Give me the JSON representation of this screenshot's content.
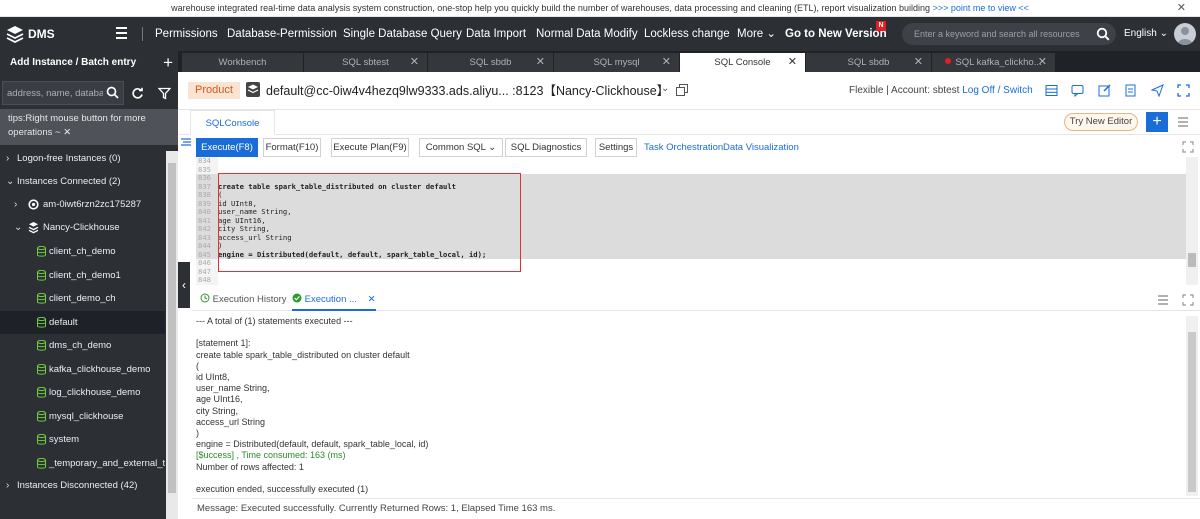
{
  "announcement": {
    "text": "warehouse integrated real-time data analysis system construction, one-stop help you quickly build the number of warehouses, data processing and cleaning (ETL), report visualization building",
    "link": ">>> point me to view <<"
  },
  "topnav": {
    "brand": "DMS",
    "menu": [
      "Permissions",
      "Database-Permission",
      "Single Database Query",
      "Data Import",
      "Normal Data Modify",
      "Lockless change",
      "More"
    ],
    "new_version": "Go to New Version",
    "new_badge": "N",
    "search_placeholder": "Enter a keyword and search all resources",
    "language": "English"
  },
  "left": {
    "add_instance": "Add Instance / Batch entry",
    "filter_placeholder": "address, name, databa",
    "tips_line1": "tips:Right mouse button for more",
    "tips_line2": "operations ~",
    "tree": {
      "logon_free": "Logon-free Instances  (0)",
      "connected": "Instances Connected  (2)",
      "inst1": "am-0iwt6rzn2zc175287",
      "inst2": "Nancy-Clickhouse",
      "dbs": [
        "client_ch_demo",
        "client_ch_demo1",
        "client_demo_ch",
        "default",
        "dms_ch_demo",
        "kafka_clickhouse_demo",
        "log_clickhouse_demo",
        "mysql_clickhouse",
        "system",
        "_temporary_and_external_ta"
      ],
      "disconnected": "Instances Disconnected  (42)"
    }
  },
  "tabs": [
    "Workbench",
    "SQL sbtest",
    "SQL sbdb",
    "SQL mysql",
    "SQL Console",
    "SQL sbdb",
    "SQL kafka_clickho..."
  ],
  "connection": {
    "product": "Product",
    "text": "default@cc-0iw4v4hezq9lw9333.ads.aliyu... :8123【Nancy-Clickhouse】",
    "account_prefix": "Flexible | Account: sbtest",
    "logoff": "Log Off / Switch"
  },
  "console": {
    "subtab": "SQLConsole",
    "try_new": "Try New Editor"
  },
  "actions": {
    "execute": "Execute(F8)",
    "format": "Format(F10)",
    "plan": "Execute Plan(F9)",
    "common_sql": "Common SQL",
    "diagnostics": "SQL Diagnostics",
    "settings": "Settings",
    "orchestration": "Task Orchestration",
    "visualization": "Data Visualization"
  },
  "editor": {
    "lines": [
      {
        "n": "834",
        "t": ""
      },
      {
        "n": "835",
        "t": ""
      },
      {
        "n": "836",
        "t": ""
      },
      {
        "n": "837",
        "t": "create table spark_table_distributed on cluster default"
      },
      {
        "n": "838",
        "t": "("
      },
      {
        "n": "839",
        "t": "id UInt8,"
      },
      {
        "n": "840",
        "t": "user_name String,"
      },
      {
        "n": "841",
        "t": "age UInt16,"
      },
      {
        "n": "842",
        "t": "city String,"
      },
      {
        "n": "843",
        "t": "access_url String"
      },
      {
        "n": "844",
        "t": ")"
      },
      {
        "n": "845",
        "t": "engine = Distributed(default, default, spark_table_local, id);"
      },
      {
        "n": "846",
        "t": ""
      },
      {
        "n": "847",
        "t": ""
      },
      {
        "n": "848",
        "t": ""
      }
    ]
  },
  "results": {
    "history_tab": "Execution History",
    "exec_tab": "Execution ...",
    "lines": [
      "--- A total of (1) statements executed ---",
      "",
      "[statement 1]:",
      "create table spark_table_distributed on cluster default",
      "(",
      "id UInt8,",
      "user_name String,",
      "age UInt16,",
      "city String,",
      "access_url String",
      ")",
      "engine = Distributed(default, default, spark_table_local, id)",
      "[$uccess] , Time consumed: 163 (ms)",
      "Number of rows affected: 1",
      "",
      "execution ended, successfully executed (1)"
    ]
  },
  "status": "Message: Executed successfully. Currently Returned Rows: 1, Elapsed Time 163 ms."
}
